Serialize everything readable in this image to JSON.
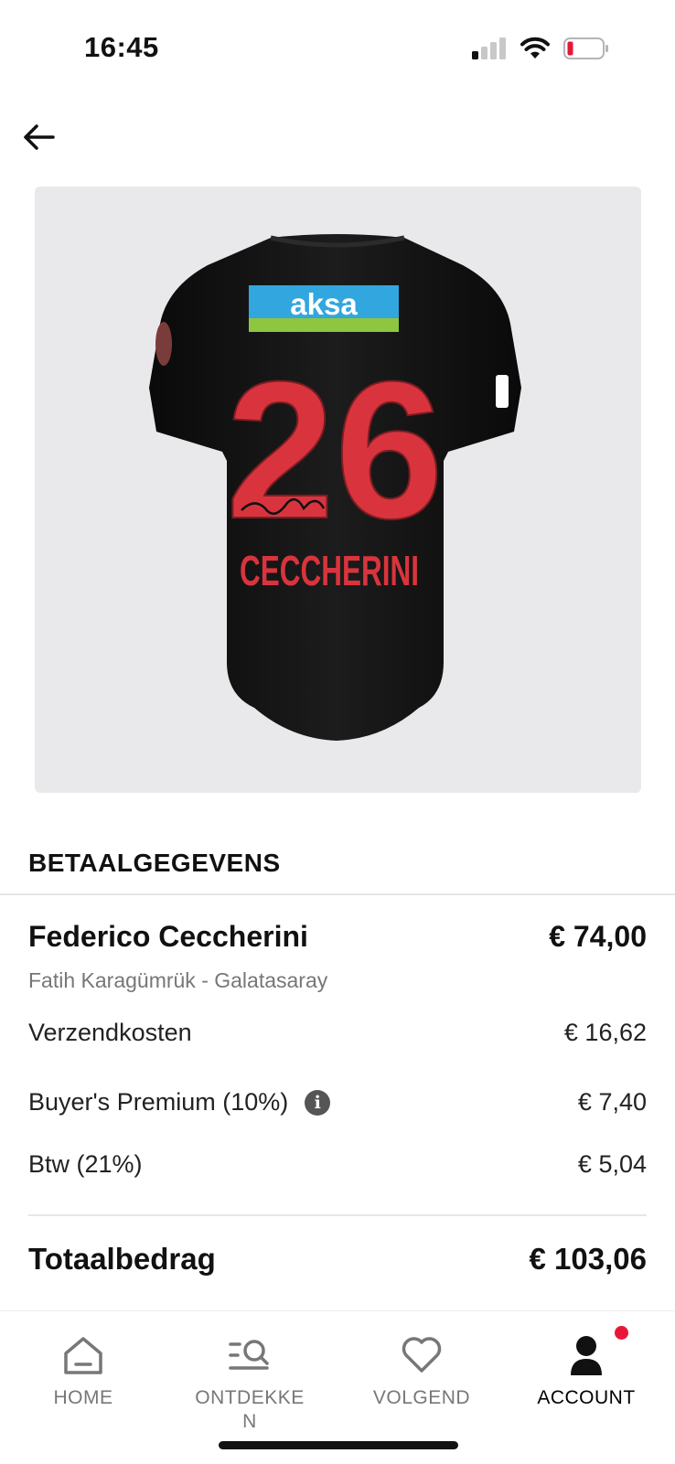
{
  "status_bar": {
    "time": "16:45",
    "icons": [
      "cellular-signal-icon",
      "wifi-icon",
      "battery-low-icon"
    ]
  },
  "nav": {
    "back_icon": "arrow-left-icon"
  },
  "product_image": {
    "sponsor": "aksa",
    "shirt_number": "26",
    "shirt_name": "CECCHERINI"
  },
  "payment": {
    "section_title": "BETAALGEGEVENS",
    "item": {
      "name": "Federico Ceccherini",
      "price": "€ 74,00",
      "subtitle": "Fatih Karagümrük - Galatasaray"
    },
    "fees": [
      {
        "label": "Verzendkosten",
        "value": "€ 16,62"
      },
      {
        "label": "Buyer's Premium (10%)",
        "value": "€ 7,40",
        "info_icon": "info-icon"
      },
      {
        "label": "Btw (21%)",
        "value": "€ 5,04"
      }
    ],
    "total": {
      "label": "Totaalbedrag",
      "value": "€ 103,06"
    }
  },
  "tab_bar": {
    "tabs": [
      {
        "label": "HOME",
        "icon": "home-icon",
        "active": false
      },
      {
        "label": "ONTDEKKEN",
        "icon": "discover-icon",
        "active": false
      },
      {
        "label": "VOLGEND",
        "icon": "heart-icon",
        "active": false
      },
      {
        "label": "ACCOUNT",
        "icon": "user-icon",
        "active": true,
        "has_notification": true
      }
    ]
  },
  "colors": {
    "accent_notification": "#e8173a",
    "shirt_number": "#d9343d",
    "sponsor_blue": "#32a6df",
    "sponsor_green": "#8dc63f"
  }
}
